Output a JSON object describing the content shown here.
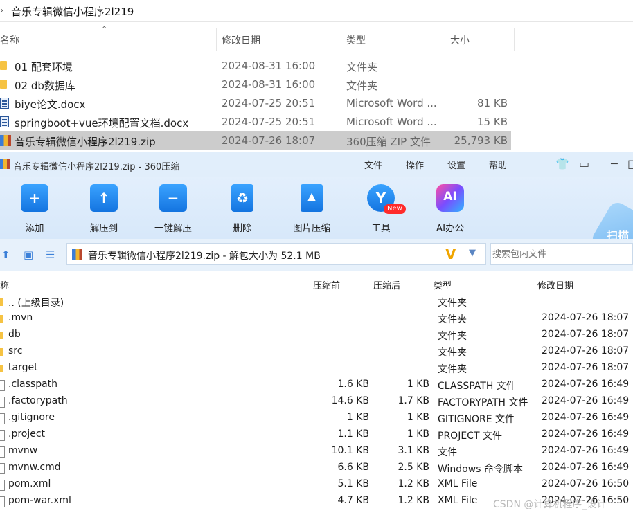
{
  "explorer": {
    "path": "音乐专辑微信小程序2l219",
    "columns": {
      "name": "名称",
      "modified": "修改日期",
      "type": "类型",
      "size": "大小"
    },
    "rows": [
      {
        "name": "01 配套环境",
        "modified": "2024-08-31 16:00",
        "type": "文件夹",
        "size": "",
        "icon": "folder-icon"
      },
      {
        "name": "02 db数据库",
        "modified": "2024-08-31 16:00",
        "type": "文件夹",
        "size": "",
        "icon": "folder-icon"
      },
      {
        "name": "biye论文.docx",
        "modified": "2024-07-25 20:51",
        "type": "Microsoft Word ...",
        "size": "81 KB",
        "icon": "word-doc-icon"
      },
      {
        "name": "springboot+vue环境配置文档.docx",
        "modified": "2024-07-25 20:51",
        "type": "Microsoft Word ...",
        "size": "15 KB",
        "icon": "word-doc-icon"
      },
      {
        "name": "音乐专辑微信小程序2l219.zip",
        "modified": "2024-07-26 18:07",
        "type": "360压缩 ZIP 文件",
        "size": "25,793 KB",
        "icon": "zip-archive-icon",
        "selected": true
      }
    ]
  },
  "zipwin": {
    "title": "音乐专辑微信小程序2l219.zip - 360压缩",
    "menu": [
      "文件",
      "操作",
      "设置",
      "帮助"
    ],
    "toolbar": [
      {
        "label": "添加",
        "icon": "add-icon"
      },
      {
        "label": "解压到",
        "icon": "extract-to-icon"
      },
      {
        "label": "一键解压",
        "icon": "one-click-extract-icon"
      },
      {
        "label": "删除",
        "icon": "recycle-bin-icon"
      },
      {
        "label": "图片压缩",
        "icon": "image-compress-icon"
      },
      {
        "label": "工具",
        "icon": "tools-icon"
      },
      {
        "label": "AI办公",
        "icon": "ai-office-icon"
      }
    ],
    "new_badge": "New",
    "scan_label": "扫描",
    "address": "音乐专辑微信小程序2l219.zip - 解包大小为 52.1 MB",
    "search_placeholder": "搜索包内文件",
    "columns": {
      "name": "称",
      "packed": "压缩前",
      "compressed": "压缩后",
      "type": "类型",
      "modified": "修改日期"
    },
    "rows": [
      {
        "name": ".. (上级目录)",
        "packed": "",
        "compressed": "",
        "type": "文件夹",
        "modified": "",
        "kind": "folder"
      },
      {
        "name": ".mvn",
        "packed": "",
        "compressed": "",
        "type": "文件夹",
        "modified": "2024-07-26 18:07",
        "kind": "folder"
      },
      {
        "name": "db",
        "packed": "",
        "compressed": "",
        "type": "文件夹",
        "modified": "2024-07-26 18:07",
        "kind": "folder"
      },
      {
        "name": "src",
        "packed": "",
        "compressed": "",
        "type": "文件夹",
        "modified": "2024-07-26 18:07",
        "kind": "folder"
      },
      {
        "name": "target",
        "packed": "",
        "compressed": "",
        "type": "文件夹",
        "modified": "2024-07-26 18:07",
        "kind": "folder"
      },
      {
        "name": ".classpath",
        "packed": "1.6 KB",
        "compressed": "1 KB",
        "type": "CLASSPATH 文件",
        "modified": "2024-07-26 16:49",
        "kind": "file"
      },
      {
        "name": ".factorypath",
        "packed": "14.6 KB",
        "compressed": "1.7 KB",
        "type": "FACTORYPATH 文件",
        "modified": "2024-07-26 16:49",
        "kind": "file"
      },
      {
        "name": ".gitignore",
        "packed": "1 KB",
        "compressed": "1 KB",
        "type": "GITIGNORE 文件",
        "modified": "2024-07-26 16:49",
        "kind": "file"
      },
      {
        "name": ".project",
        "packed": "1.1 KB",
        "compressed": "1 KB",
        "type": "PROJECT 文件",
        "modified": "2024-07-26 16:49",
        "kind": "file"
      },
      {
        "name": "mvnw",
        "packed": "10.1 KB",
        "compressed": "3.1 KB",
        "type": "文件",
        "modified": "2024-07-26 16:49",
        "kind": "file"
      },
      {
        "name": "mvnw.cmd",
        "packed": "6.6 KB",
        "compressed": "2.5 KB",
        "type": "Windows 命令脚本",
        "modified": "2024-07-26 16:49",
        "kind": "file"
      },
      {
        "name": "pom.xml",
        "packed": "5.1 KB",
        "compressed": "1.2 KB",
        "type": "XML File",
        "modified": "2024-07-26 16:50",
        "kind": "file"
      },
      {
        "name": "pom-war.xml",
        "packed": "4.7 KB",
        "compressed": "1.2 KB",
        "type": "XML File",
        "modified": "2024-07-26 16:50",
        "kind": "file"
      }
    ]
  },
  "watermark": "CSDN @计算机程序_设计"
}
